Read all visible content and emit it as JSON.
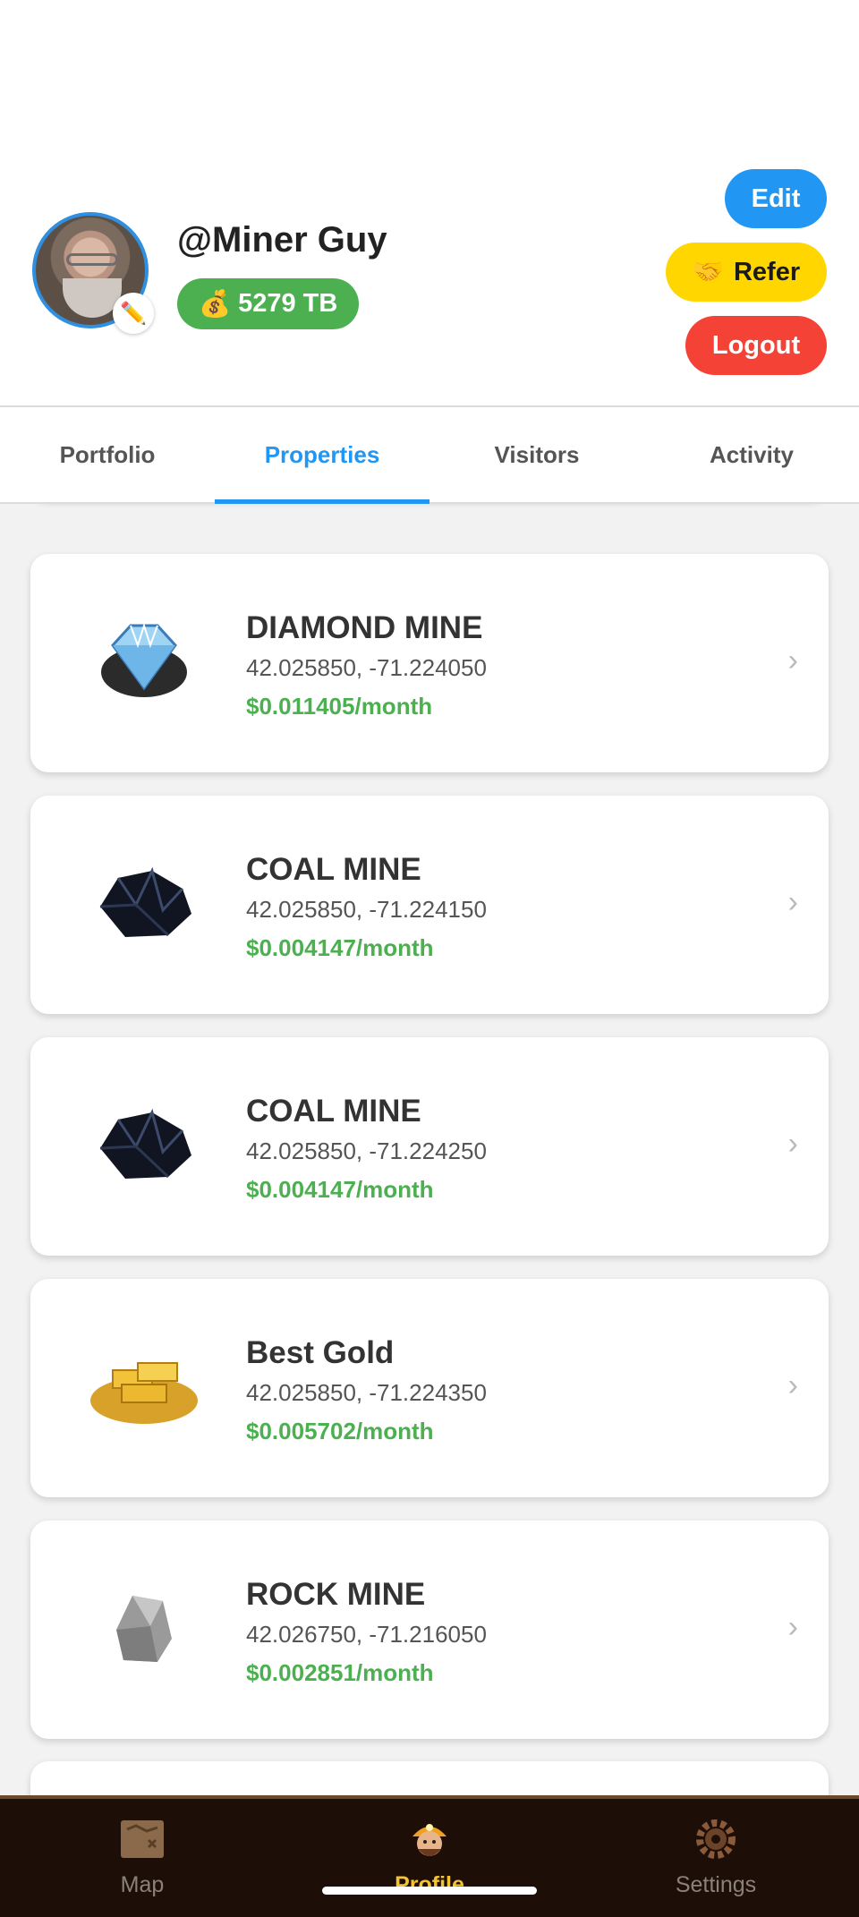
{
  "profile": {
    "username": "@Miner Guy",
    "balance": "5279 TB",
    "balance_icon": "money-bag-icon",
    "edit_icon": "pencil-icon"
  },
  "actions": {
    "edit_label": "Edit",
    "refer_label": "Refer",
    "refer_icon": "handshake-icon",
    "logout_label": "Logout"
  },
  "tabs": [
    {
      "label": "Portfolio",
      "active": false
    },
    {
      "label": "Properties",
      "active": true
    },
    {
      "label": "Visitors",
      "active": false
    },
    {
      "label": "Activity",
      "active": false
    }
  ],
  "properties": [
    {
      "title": "DIAMOND MINE",
      "coords": "42.025850, -71.224050",
      "price": "$0.011405/month",
      "icon": "diamond-icon"
    },
    {
      "title": "COAL MINE",
      "coords": "42.025850, -71.224150",
      "price": "$0.004147/month",
      "icon": "coal-icon"
    },
    {
      "title": "COAL MINE",
      "coords": "42.025850, -71.224250",
      "price": "$0.004147/month",
      "icon": "coal-icon"
    },
    {
      "title": "Best Gold",
      "coords": "42.025850, -71.224350",
      "price": "$0.005702/month",
      "icon": "gold-icon"
    },
    {
      "title": "ROCK MINE",
      "coords": "42.026750, -71.216050",
      "price": "$0.002851/month",
      "icon": "rock-icon"
    }
  ],
  "nav": [
    {
      "label": "Map",
      "icon": "map-icon",
      "active": false
    },
    {
      "label": "Profile",
      "icon": "miner-icon",
      "active": true
    },
    {
      "label": "Settings",
      "icon": "gear-icon",
      "active": false
    }
  ],
  "colors": {
    "accent_blue": "#2196f3",
    "money_green": "#4caf50",
    "refer_yellow": "#ffd600",
    "logout_red": "#f44336",
    "nav_bg": "#1d0e07",
    "nav_active": "#f4c430"
  }
}
